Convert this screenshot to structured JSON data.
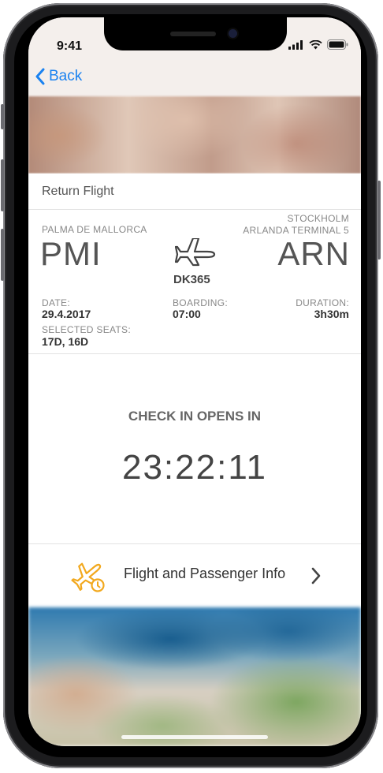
{
  "status": {
    "time": "9:41"
  },
  "nav": {
    "back_label": "Back"
  },
  "flight": {
    "section_title": "Return Flight",
    "origin": {
      "city": "PALMA DE MALLORCA",
      "code": "PMI"
    },
    "destination": {
      "city": "STOCKHOLM",
      "terminal": "ARLANDA TERMINAL 5",
      "code": "ARN"
    },
    "flight_number": "DK365",
    "date_label": "DATE:",
    "date": "29.4.2017",
    "boarding_label": "BOARDING:",
    "boarding": "07:00",
    "duration_label": "DURATION:",
    "duration": "3h30m",
    "seats_label": "SELECTED SEATS:",
    "seats": "17D, 16D"
  },
  "checkin": {
    "label": "CHECK IN OPENS IN",
    "countdown": "23:22:11"
  },
  "info": {
    "label": "Flight and Passenger Info"
  },
  "colors": {
    "accent_blue": "#1a82f0",
    "info_icon_orange": "#f2a81d"
  },
  "icons": [
    "chevron-left-icon",
    "plane-icon",
    "plane-info-icon",
    "chevron-right-icon",
    "signal-icon",
    "wifi-icon",
    "battery-icon"
  ]
}
